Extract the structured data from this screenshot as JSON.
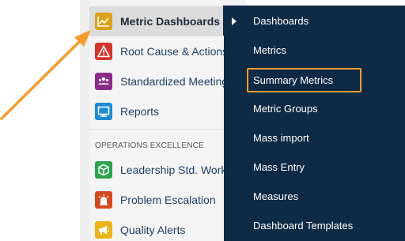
{
  "sidebar": {
    "items": [
      {
        "label": "Metric Dashboards",
        "icon": "line-chart-icon",
        "color": "#d9a21b",
        "active": true
      },
      {
        "label": "Root Cause & Actions",
        "icon": "warning-icon",
        "color": "#d6342c",
        "active": false
      },
      {
        "label": "Standardized Meetings",
        "icon": "people-icon",
        "color": "#8a2d8a",
        "active": false
      },
      {
        "label": "Reports",
        "icon": "monitor-icon",
        "color": "#1c8ad1",
        "active": false
      }
    ],
    "section_header": "OPERATIONS EXCELLENCE",
    "section_items": [
      {
        "label": "Leadership Std. Work",
        "icon": "cube-icon",
        "color": "#2da44e"
      },
      {
        "label": "Problem Escalation",
        "icon": "alarm-icon",
        "color": "#d34a1f"
      },
      {
        "label": "Quality Alerts",
        "icon": "megaphone-icon",
        "color": "#e8b417"
      }
    ]
  },
  "submenu": {
    "items": [
      {
        "label": "Dashboards"
      },
      {
        "label": "Metrics"
      },
      {
        "label": "Summary Metrics",
        "highlighted": true
      },
      {
        "label": "Metric Groups"
      },
      {
        "label": "Mass import"
      },
      {
        "label": "Mass Entry"
      },
      {
        "label": "Measures"
      },
      {
        "label": "Dashboard Templates"
      }
    ]
  },
  "annotation": {
    "arrow_color": "#f39c30",
    "highlight_color": "#f39c30"
  }
}
